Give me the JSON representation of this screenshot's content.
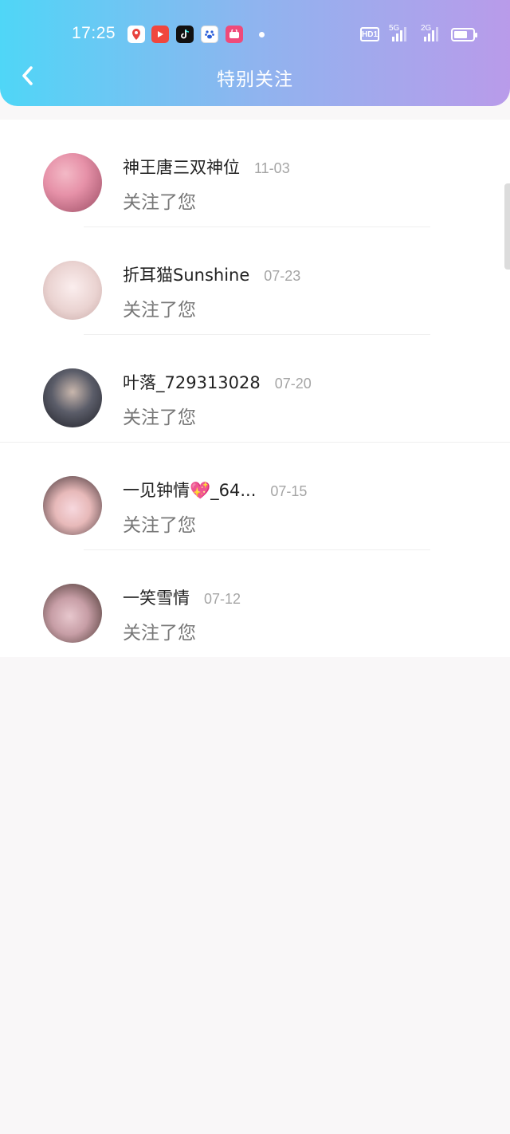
{
  "status_bar": {
    "time": "17:25",
    "hd_label": "HD1",
    "network_1": "5G",
    "network_2": "2G",
    "app_icons": [
      "location-app-icon",
      "video-app-icon",
      "tiktok-app-icon",
      "baidu-app-icon",
      "shop-app-icon"
    ]
  },
  "header": {
    "title": "特别关注",
    "back_icon": "chevron-left-icon",
    "gradient": [
      "#4fd6f7",
      "#b99bea"
    ]
  },
  "notifications": [
    {
      "name": "神王唐三双神位",
      "date": "11-03",
      "text": "关注了您",
      "avatar_colors": [
        "#f3b9c6",
        "#9a4c63"
      ]
    },
    {
      "name": "折耳猫Sunshine",
      "date": "07-23",
      "text": "关注了您",
      "avatar_colors": [
        "#f6ecec",
        "#c7a8a6"
      ]
    },
    {
      "name": "叶落_729313028",
      "date": "07-20",
      "text": "关注了您",
      "avatar_colors": [
        "#5b5d69",
        "#1f2027"
      ]
    },
    {
      "name": "一见钟情💖_64...",
      "date": "07-15",
      "text": "关注了您",
      "avatar_colors": [
        "#f7d8de",
        "#3a2b2f"
      ]
    },
    {
      "name": "一笑雪情",
      "date": "07-12",
      "text": "关注了您",
      "avatar_colors": [
        "#c79ea6",
        "#3b2a24"
      ]
    }
  ]
}
